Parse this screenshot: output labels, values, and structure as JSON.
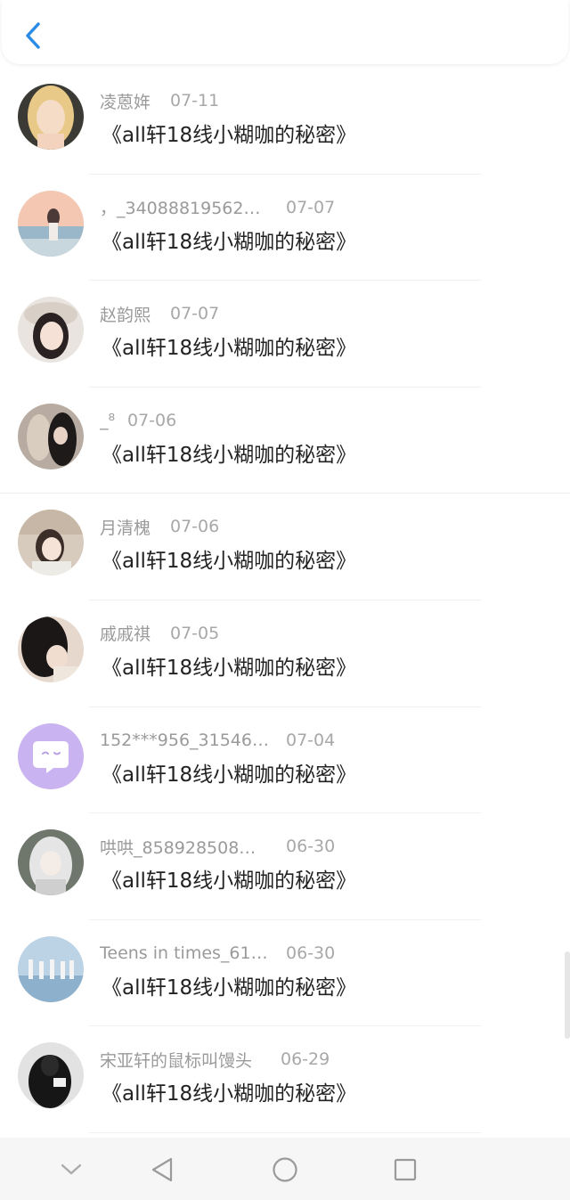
{
  "header": {
    "back_icon": "chevron-left-icon"
  },
  "items": [
    {
      "name": "凌蒽姩",
      "date": "07-11",
      "title": "《all轩18线小糊咖的秘密》",
      "avatar": "photo-blonde-girl"
    },
    {
      "name": "，_34088819562…",
      "date": "07-07",
      "title": "《all轩18线小糊咖的秘密》",
      "avatar": "photo-beach-girl"
    },
    {
      "name": "赵韵熙",
      "date": "07-07",
      "title": "《all轩18线小糊咖的秘密》",
      "avatar": "photo-girl-hat"
    },
    {
      "name": "_⁸",
      "date": "07-06",
      "title": "《all轩18线小糊咖的秘密》",
      "avatar": "photo-two-girls"
    },
    {
      "name": "月清槐",
      "date": "07-06",
      "title": "《all轩18线小糊咖的秘密》",
      "avatar": "photo-girl-car"
    },
    {
      "name": "戚戚祺",
      "date": "07-05",
      "title": "《all轩18线小糊咖的秘密》",
      "avatar": "photo-dark-hair-girl"
    },
    {
      "name": "152***956_31546…",
      "date": "07-04",
      "title": "《all轩18线小糊咖的秘密》",
      "avatar": "default-chat-avatar"
    },
    {
      "name": "哄哄_858928508…",
      "date": "06-30",
      "title": "《all轩18线小糊咖的秘密》",
      "avatar": "anime-white-hair"
    },
    {
      "name": "Teens in times_61…",
      "date": "06-30",
      "title": "《all轩18线小糊咖的秘密》",
      "avatar": "photo-group-sea"
    },
    {
      "name": "宋亚轩的鼠标叫馒头",
      "date": "06-29",
      "title": "《all轩18线小糊咖的秘密》",
      "avatar": "photo-dark-figure"
    }
  ],
  "navbar": {
    "buttons": [
      "chevron-down-icon",
      "back-triangle-icon",
      "home-circle-icon",
      "recents-square-icon"
    ]
  },
  "colors": {
    "accent": "#2b8ce8",
    "name_text": "#9a9a9a",
    "title_text": "#222222",
    "default_avatar": "#c9b3f0"
  }
}
